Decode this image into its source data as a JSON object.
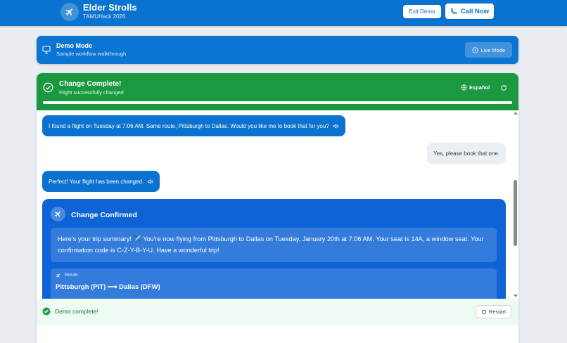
{
  "header": {
    "title": "Elder Strolls",
    "subtitle": "TAMUHack 2026",
    "exit_label": "Exit Demo",
    "call_label": "Call Now",
    "logo_icon": "plane-icon"
  },
  "demo_banner": {
    "title": "Demo Mode",
    "subtitle": "Sample workflow walkthrough",
    "live_label": "Live Mode"
  },
  "status": {
    "title": "Change Complete!",
    "subtitle": "Flight successfully changed",
    "language_label": "Español",
    "progress": 1.0
  },
  "chat": {
    "messages": [
      {
        "role": "assistant",
        "text": "I found a flight on Tuesday at 7:06 AM. Same route, Pittsburgh to Dallas. Would you like me to book that for you?"
      },
      {
        "role": "user",
        "text": "Yes, please book that one."
      },
      {
        "role": "assistant",
        "text": "Perfect! Your flight has been changed."
      }
    ],
    "confirmation": {
      "title": "Change Confirmed",
      "summary": "Here's your trip summary! ✈️ You're now flying from Pittsburgh to Dallas on Tuesday, January 20th at 7:06 AM. Your seat is 14A, a window seat. Your confirmation code is C-Z-Y-B-Y-U. Have a wonderful trip!",
      "route_label": "Route",
      "route_value": "Pittsburgh (PIT) ⟶ Dallas (DFW)"
    }
  },
  "footer": {
    "text": "Demo complete!",
    "restart_label": "Restart"
  },
  "colors": {
    "primary": "#0a73cf",
    "success": "#1b9940",
    "confirm": "#0e63d6"
  }
}
